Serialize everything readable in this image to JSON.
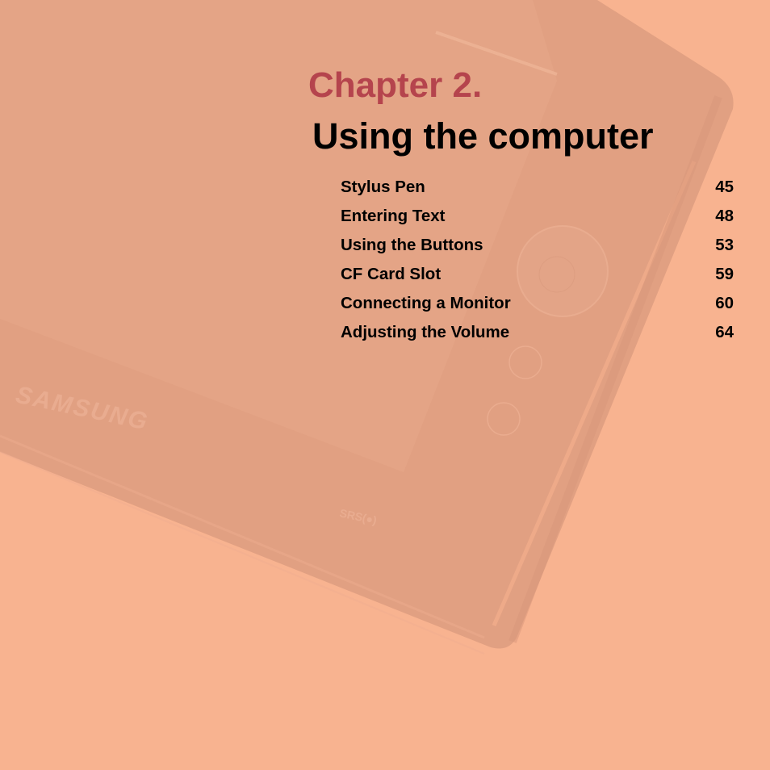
{
  "chapter": {
    "label": "Chapter 2.",
    "title": "Using the computer",
    "accent_color": "#b5444d",
    "background_color": "#f8b390"
  },
  "toc": {
    "items": [
      {
        "label": "Stylus Pen",
        "page": "45"
      },
      {
        "label": "Entering Text",
        "page": "48"
      },
      {
        "label": "Using the Buttons",
        "page": "53"
      },
      {
        "label": "CF Card Slot",
        "page": "59"
      },
      {
        "label": "Connecting a Monitor",
        "page": "60"
      },
      {
        "label": "Adjusting the Volume",
        "page": "64"
      }
    ]
  },
  "background_image": {
    "subject": "samsung-ultra-mobile-pc",
    "brand_text": "SAMSUNG",
    "badge_text": "SRS"
  }
}
